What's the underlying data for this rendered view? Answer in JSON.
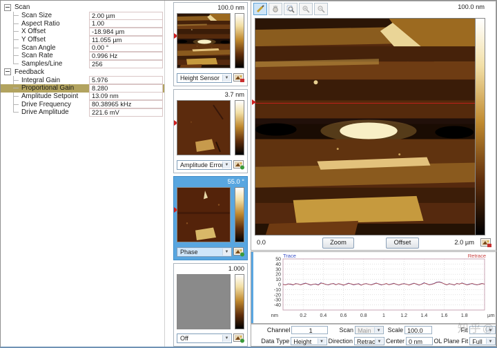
{
  "tree": {
    "groups": [
      {
        "label": "Scan",
        "items": [
          {
            "label": "Scan Size",
            "value": "2.00 µm"
          },
          {
            "label": "Aspect Ratio",
            "value": "1.00"
          },
          {
            "label": "X Offset",
            "value": "-18.984 µm"
          },
          {
            "label": "Y Offset",
            "value": "11.055 µm"
          },
          {
            "label": "Scan Angle",
            "value": "0.00 °"
          },
          {
            "label": "Scan Rate",
            "value": "0.996 Hz"
          },
          {
            "label": "Samples/Line",
            "value": "256"
          }
        ]
      },
      {
        "label": "Feedback",
        "items": [
          {
            "label": "Integral Gain",
            "value": "5.976"
          },
          {
            "label": "Proportional Gain",
            "value": "8.280",
            "highlighted": true
          },
          {
            "label": "Amplitude Setpoint",
            "value": "13.09 nm"
          },
          {
            "label": "Drive Frequency",
            "value": "80.38965 kHz"
          },
          {
            "label": "Drive Amplitude",
            "value": "221.6 mV"
          }
        ]
      }
    ]
  },
  "thumbnails": [
    {
      "channel": "Height Sensor",
      "scale": "100.0 nm",
      "selected": false,
      "capture_icon": "export-red"
    },
    {
      "channel": "Amplitude Error",
      "scale": "3.7 nm",
      "selected": false,
      "capture_icon": "export-green"
    },
    {
      "channel": "Phase",
      "scale": "55.0 °",
      "selected": true,
      "capture_icon": "export-green"
    },
    {
      "channel": "Off",
      "scale": "1.000",
      "selected": false,
      "capture_icon": "export-green"
    }
  ],
  "main_view": {
    "toolbar_tools": [
      "draw-tool",
      "pan-tool",
      "zoom-box-tool",
      "zoom-in-tool",
      "zoom-out-tool"
    ],
    "scale_label": "100.0 nm",
    "x_start_label": "0.0",
    "x_end_label": "2.0 µm",
    "zoom_button": "Zoom",
    "offset_button": "Offset"
  },
  "controls": {
    "row1": [
      {
        "label": "Channel",
        "value": "1"
      },
      {
        "label": "Scan",
        "value": "Main",
        "disabled": true
      },
      {
        "label": "Scale",
        "value": "100.0 nm"
      },
      {
        "label": "Fit",
        "value": ""
      }
    ],
    "row2": [
      {
        "label": "Data Type",
        "value": "Height Senso"
      },
      {
        "label": "Direction",
        "value": "Retrace"
      },
      {
        "label": "Center",
        "value": "0 nm"
      },
      {
        "label": "OL Plane Fit",
        "value": "Full"
      }
    ]
  },
  "watermark": "知乎@",
  "chart_data": {
    "type": "line",
    "title": "",
    "xlabel": "µm",
    "ylabel": "nm",
    "xlim": [
      0,
      2.0
    ],
    "ylim": [
      -50,
      50
    ],
    "x_ticks": [
      0.2,
      0.4,
      0.6,
      0.8,
      1,
      1.2,
      1.4,
      1.6,
      1.8
    ],
    "y_ticks": [
      50,
      40,
      30,
      20,
      10,
      0,
      -10,
      -20,
      -30,
      -40
    ],
    "grid": true,
    "legend_position": "top-corners",
    "x_step": 0.025,
    "series": [
      {
        "name": "Trace",
        "color": "#4a4ab0",
        "values": [
          0.5,
          -0.8,
          1.2,
          0.3,
          -1.1,
          2.0,
          0.8,
          -0.5,
          1.5,
          2.8,
          0.6,
          -1.4,
          0.2,
          1.1,
          -0.7,
          3.2,
          1.8,
          0.4,
          -1.0,
          0.9,
          2.2,
          -0.3,
          1.4,
          0.1,
          -1.6,
          0.7,
          2.5,
          1.0,
          -0.9,
          0.3,
          1.8,
          -1.2,
          0.5,
          2.0,
          0.2,
          -0.6,
          1.3,
          3.0,
          0.8,
          -1.1,
          0.4,
          1.6,
          -0.2,
          0.9,
          2.4,
          0.1,
          -1.3,
          0.6,
          1.9,
          0.3,
          -0.8,
          1.1,
          2.6,
          0.5,
          -1.5,
          0.8,
          3.4,
          1.2,
          -0.4,
          0.7,
          2.1,
          4.5,
          5.2,
          3.8,
          1.0,
          -0.9,
          1.7,
          0.2,
          -1.2,
          2.3,
          0.6,
          3.1,
          1.4,
          -0.5,
          0.9,
          1.8,
          0.1,
          -1.0,
          0.8,
          2.2,
          0.4
        ]
      },
      {
        "name": "Retrace",
        "color": "#b04848",
        "values": [
          0.2,
          -1.0,
          0.8,
          0.9,
          -0.6,
          1.4,
          1.2,
          -1.0,
          1.0,
          2.2,
          1.1,
          -0.8,
          0.6,
          0.5,
          -1.2,
          2.6,
          2.2,
          -0.2,
          -0.5,
          1.3,
          1.6,
          -0.8,
          1.8,
          0.5,
          -1.1,
          0.2,
          2.0,
          1.4,
          -0.4,
          0.8,
          1.2,
          -1.6,
          0.9,
          1.5,
          0.6,
          -1.0,
          0.8,
          2.4,
          1.2,
          -0.6,
          0.0,
          2.0,
          -0.7,
          0.5,
          1.9,
          0.5,
          -0.9,
          1.0,
          1.4,
          0.7,
          -1.2,
          0.6,
          2.1,
          0.9,
          -1.0,
          0.3,
          2.9,
          1.6,
          -0.8,
          0.2,
          1.7,
          3.9,
          4.6,
          3.2,
          1.4,
          -0.5,
          1.2,
          0.6,
          -0.8,
          1.8,
          1.0,
          2.6,
          0.9,
          -0.9,
          0.4,
          2.2,
          0.5,
          -0.6,
          0.3,
          1.8,
          0.8
        ]
      }
    ]
  }
}
